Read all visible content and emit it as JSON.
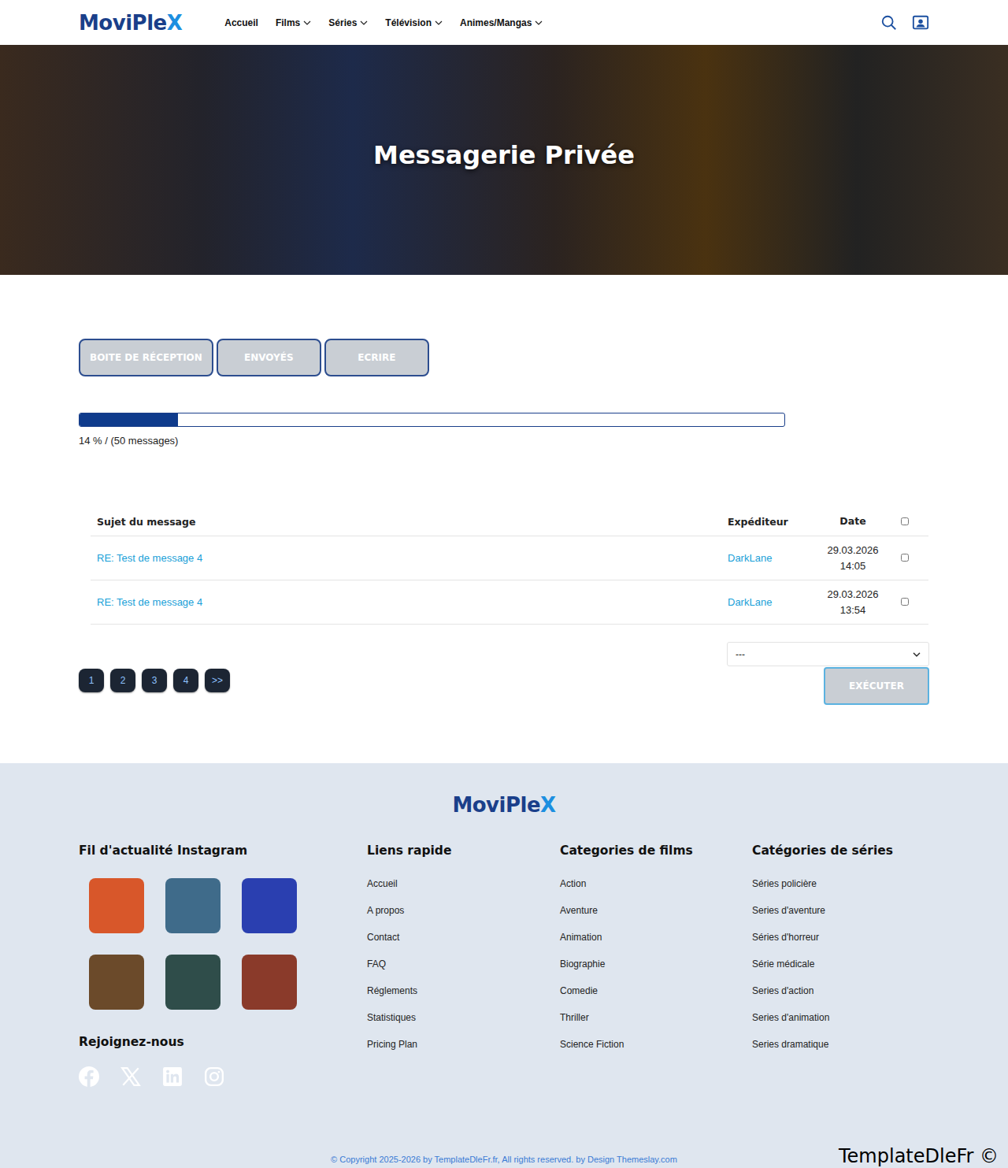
{
  "header": {
    "logo": {
      "main": "MoviPle",
      "accent": "X"
    },
    "nav": [
      {
        "label": "Accueil",
        "has_menu": false
      },
      {
        "label": "Films",
        "has_menu": true
      },
      {
        "label": "Séries",
        "has_menu": true
      },
      {
        "label": "Télévision",
        "has_menu": true
      },
      {
        "label": "Animes/Mangas",
        "has_menu": true
      }
    ]
  },
  "hero": {
    "title": "Messagerie Privée"
  },
  "tabs": [
    {
      "label": "BOITE DE RÉCEPTION",
      "selected": false
    },
    {
      "label": "ENVOYÉS",
      "selected": false
    },
    {
      "label": "ECRIRE",
      "selected": false
    }
  ],
  "quota": {
    "level": 0.14,
    "label": "14 % / (50 messages)"
  },
  "table": {
    "columns": [
      "Sujet du message",
      "Expéditeur",
      "Date"
    ],
    "select_all": false,
    "rows": [
      {
        "subject": "RE: Test de message 4",
        "sender": "DarkLane",
        "date": "29.03.2026",
        "time": "14:05",
        "checked": false
      },
      {
        "subject": "RE: Test de message 4",
        "sender": "DarkLane",
        "date": "29.03.2026",
        "time": "13:54",
        "checked": false
      }
    ]
  },
  "pagination": [
    {
      "label": "1",
      "selected": false
    },
    {
      "label": "2",
      "selected": false
    },
    {
      "label": "3",
      "selected": false
    },
    {
      "label": "4",
      "selected": false
    },
    {
      "label": ">>",
      "selected": false
    }
  ],
  "actions": {
    "select_value": "---",
    "button": "EXÉCUTER"
  },
  "footer": {
    "logo": {
      "main": "MoviPle",
      "accent": "X"
    },
    "instagram_title": "Fil d'actualité Instagram",
    "social_title": "Rejoignez-nous",
    "columns": [
      {
        "title": "Liens rapide",
        "links": [
          "Accueil",
          "A propos",
          "Contact",
          "FAQ",
          "Réglements",
          "Statistiques",
          "Pricing Plan"
        ]
      },
      {
        "title": "Categories de films",
        "links": [
          "Action",
          "Aventure",
          "Animation",
          "Biographie",
          "Comedie",
          "Thriller",
          "Science Fiction"
        ]
      },
      {
        "title": "Catégories de séries",
        "links": [
          "Séries policière",
          "Series d'aventure",
          "Séries d'horreur",
          "Série médicale",
          "Series d'action",
          "Series d'animation",
          "Series dramatique"
        ]
      }
    ],
    "copyright": "© Copyright 2025-2026 by TemplateDleFr.fr, All rights reserved. by Design Themeslay.com"
  },
  "watermark": "TemplateDleFr ©"
}
